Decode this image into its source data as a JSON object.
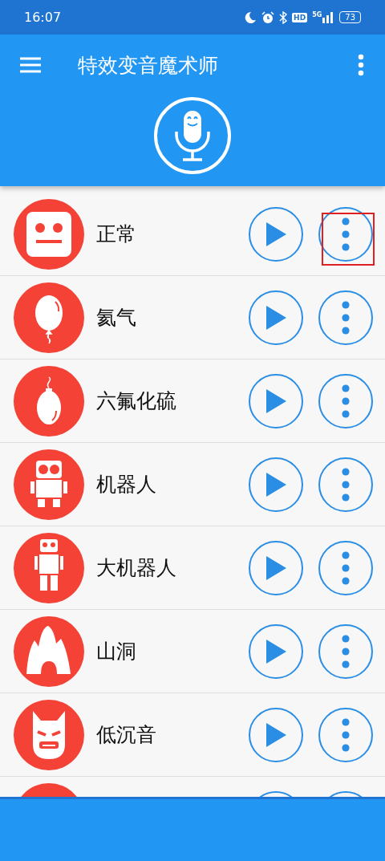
{
  "status_bar": {
    "time": "16:07",
    "hd": "HD",
    "network": "5G",
    "battery": "73"
  },
  "app_bar": {
    "title": "特效变音魔术师"
  },
  "effects": [
    {
      "kind": "face",
      "label": "正常",
      "highlighted": true
    },
    {
      "kind": "balloon",
      "label": "氦气",
      "highlighted": false
    },
    {
      "kind": "heavy-balloon",
      "label": "六氟化硫",
      "highlighted": false
    },
    {
      "kind": "robot",
      "label": "机器人",
      "highlighted": false
    },
    {
      "kind": "tall-robot",
      "label": "大机器人",
      "highlighted": false
    },
    {
      "kind": "cave",
      "label": "山洞",
      "highlighted": false
    },
    {
      "kind": "mask",
      "label": "低沉音",
      "highlighted": false
    },
    {
      "kind": "blank",
      "highlighted": false
    }
  ]
}
